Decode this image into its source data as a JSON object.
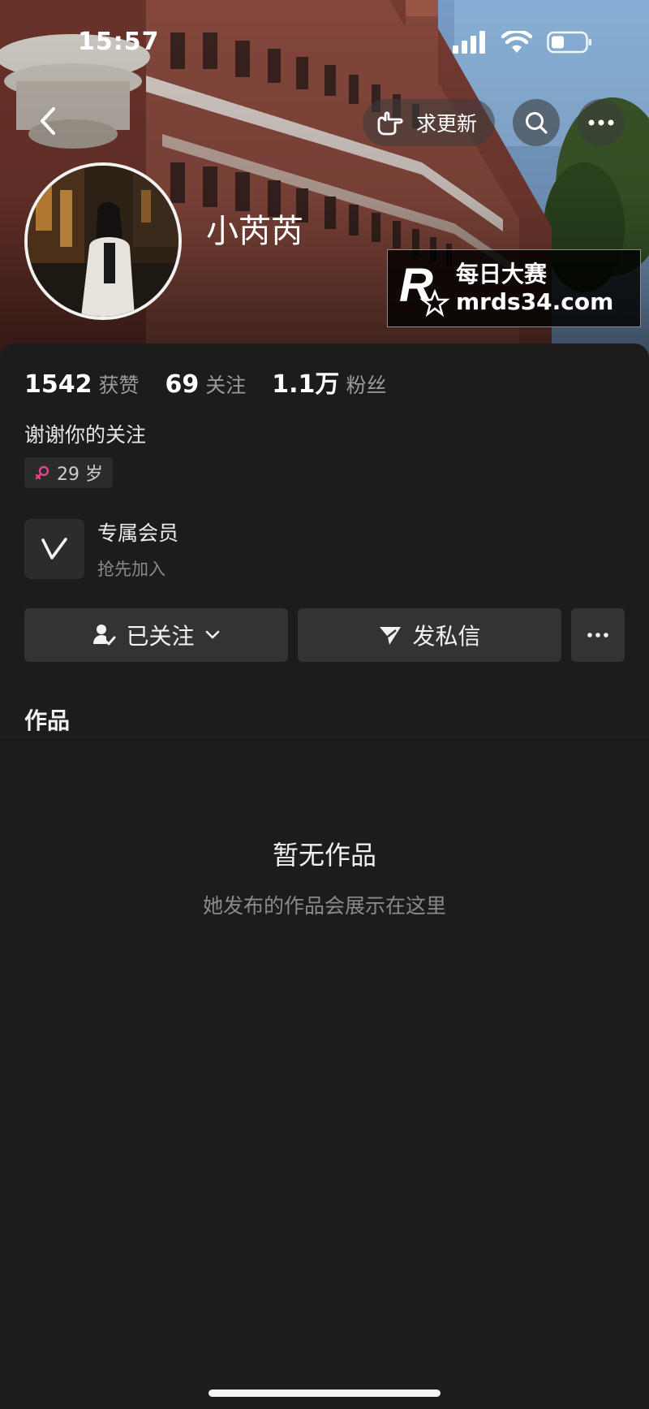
{
  "status_bar": {
    "time": "15:57",
    "icons": [
      "signal-icon",
      "wifi-icon",
      "battery-icon"
    ]
  },
  "header": {
    "back_icon": "chevron-left-icon",
    "request_update_label": "求更新",
    "request_update_icon": "pointing-hand-icon",
    "search_icon": "search-icon",
    "more_icon": "ellipsis-icon"
  },
  "profile": {
    "name": "小芮芮",
    "stats": [
      {
        "value": "1542",
        "label": "获赞"
      },
      {
        "value": "69",
        "label": "关注"
      },
      {
        "value": "1.1万",
        "label": "粉丝"
      }
    ],
    "bio": "谢谢你的关注",
    "age_tag": "29 岁",
    "gender_icon": "female-icon"
  },
  "membership": {
    "title": "专属会员",
    "subtitle": "抢先加入",
    "icon": "v-badge-icon"
  },
  "actions": {
    "follow_label": "已关注",
    "message_label": "发私信"
  },
  "works": {
    "title": "作品",
    "empty_title": "暂无作品",
    "empty_subtitle": "她发布的作品会展示在这里"
  },
  "watermark": {
    "brand_cn": "每日大赛",
    "url": "mrds34.com"
  },
  "colors": {
    "background": "#161616",
    "sheet": "#1c1c1c",
    "button": "#333333",
    "gender_icon": "#d9488f"
  }
}
